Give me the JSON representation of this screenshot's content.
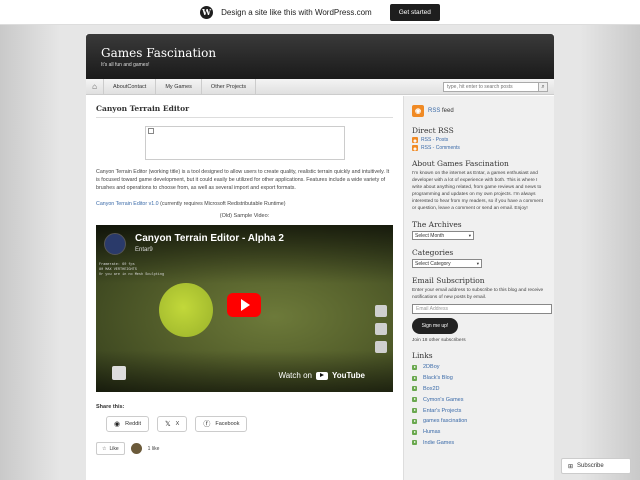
{
  "wpbar": {
    "logo": "W",
    "text": "Design a site like this with WordPress.com",
    "cta": "Get started"
  },
  "header": {
    "title": "Games Fascination",
    "tagline": "It's all fun and games!"
  },
  "nav": {
    "home_icon": "⌂",
    "items": [
      "AboutContact",
      "My Games",
      "Other Projects"
    ],
    "search_placeholder": "type, hit enter to search posts",
    "search_icon": "⌕"
  },
  "post": {
    "title": "Canyon Terrain Editor",
    "body": "Canyon Terrain Editor (working title) is a tool designed to allow users to create quality, realistic terrain quickly and intuitively. It is focused toward game development, but it could easily be utilized for other applications. Features include a wide variety of brushes and operations to choose from, as well as several import and export formats.",
    "link_text": "Canyon Terrain Editor v1.0",
    "link_suffix": " (currently requires Microsoft Redistributable Runtime)",
    "caption": "(Old) Sample Video:"
  },
  "video": {
    "title": "Canyon Terrain Editor - Alpha 2",
    "channel": "Entar9",
    "watch_on": "Watch on",
    "yt_word": "YouTube",
    "hud": [
      "Framerate: 60 fps",
      "80 MAX VERTHEIGHTS",
      "Or you are in no Mesh Sculpting"
    ]
  },
  "share": {
    "heading": "Share this:",
    "buttons": [
      {
        "icon": "◉",
        "label": "Reddit"
      },
      {
        "icon": "𝕏",
        "label": "X"
      },
      {
        "icon": "ⓕ",
        "label": "Facebook"
      }
    ]
  },
  "like": {
    "icon": "☆",
    "label": "Like",
    "count": "1 like"
  },
  "sidebar": {
    "rss_icon": "◉",
    "rss_label": "RSS",
    "rss_suffix": " feed",
    "direct_rss": "Direct RSS",
    "rss_posts": "RSS - Posts",
    "rss_comments": "RSS - Comments",
    "about_title": "About Games Fascination",
    "about_text": "I'm known on the internet as Entar, a games enthusiast and developer with a lot of experience with both. This is where I write about anything related, from game reviews and news to programming and updates on my own projects. I'm always interested to hear from my readers, so if you have a comment or question, leave a comment or send an email. Enjoy!",
    "archives_title": "The Archives",
    "archives_select": "Select Month",
    "categories_title": "Categories",
    "categories_select": "Select Category",
    "email_title": "Email Subscription",
    "email_text": "Enter your email address to subscribe to this blog and receive notifications of new posts by email.",
    "email_placeholder": "Email Address",
    "signup": "Sign me up!",
    "join": "Join 18 other subscribers",
    "links_title": "Links",
    "links": [
      "2DBoy",
      "Black's Blog",
      "Box2D",
      "Cymon's Games",
      "Entar's Projects",
      "games fascination",
      "Humas",
      "Indie Games"
    ]
  },
  "subscribe": {
    "icon": "⊞",
    "label": "Subscribe"
  }
}
